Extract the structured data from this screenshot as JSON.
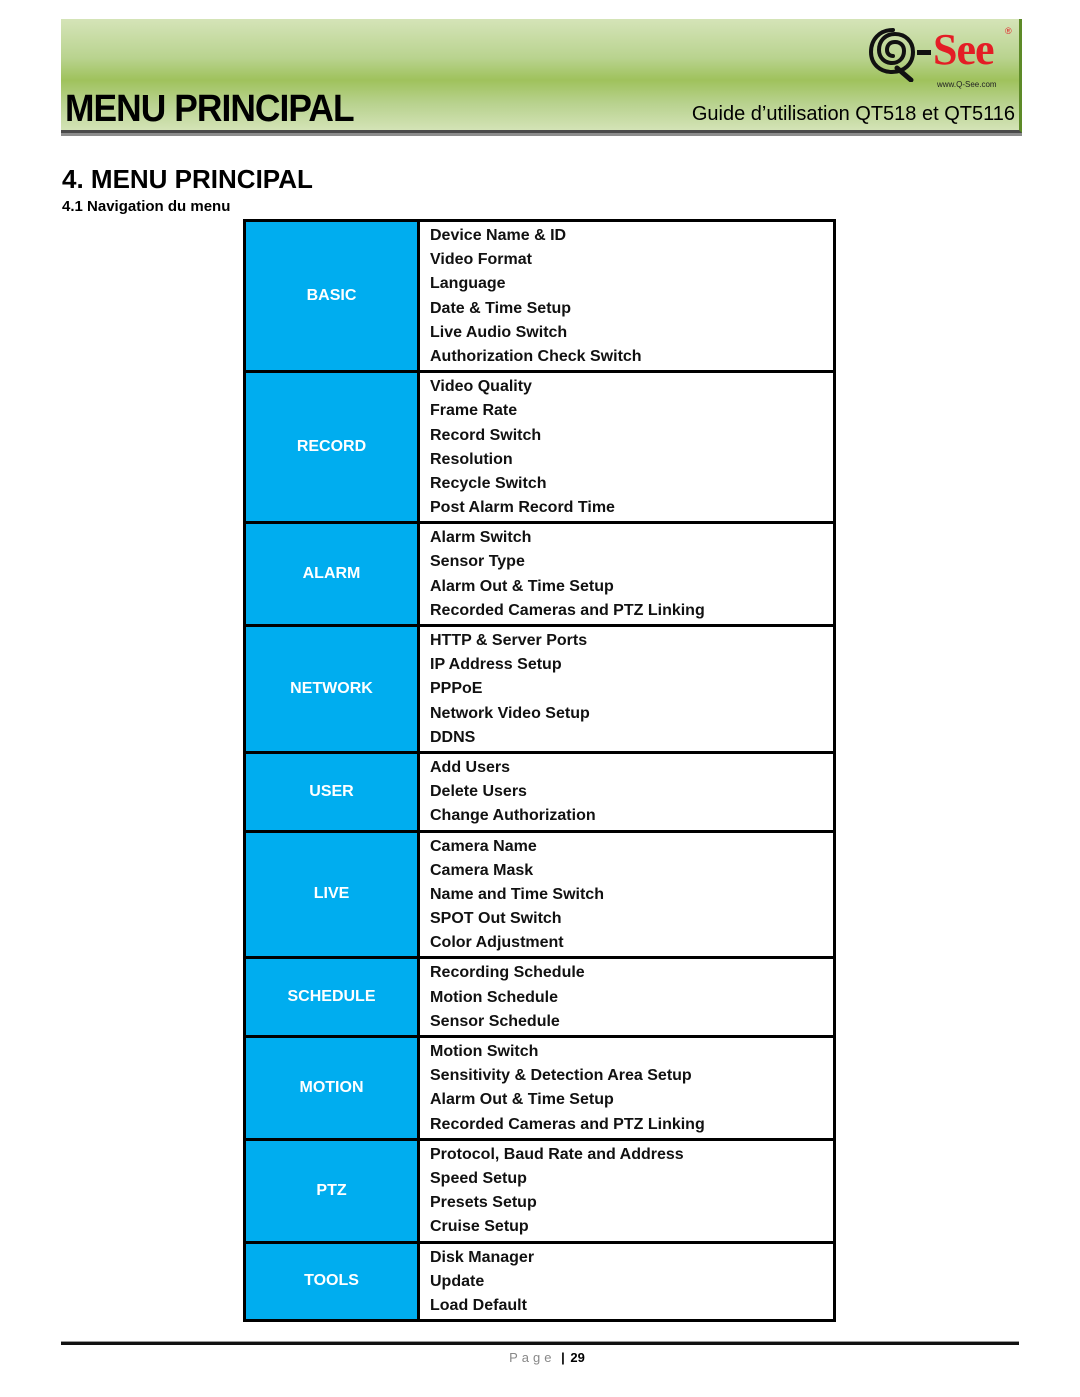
{
  "header": {
    "title": "MENU PRINCIPAL",
    "subtitle": "Guide d’utilisation QT518 et QT5116",
    "logo": {
      "icon": "q-see-swirl-icon",
      "brand_prefix": "Q",
      "brand_name": "See",
      "registered": "®",
      "url": "www.Q-See.com"
    },
    "colors": {
      "banner_green": "#9fc25c",
      "logo_red": "#e41d25"
    }
  },
  "section": {
    "heading": "4. MENU PRINCIPAL",
    "subheading": "4.1 Navigation du menu"
  },
  "menu": {
    "colors": {
      "category_bg": "#00adef",
      "category_text": "#ffffff",
      "border": "#000000"
    },
    "groups": [
      {
        "category": "BASIC",
        "items": [
          "Device Name & ID",
          "Video Format",
          "Language",
          "Date & Time Setup",
          "Live Audio Switch",
          "Authorization Check Switch"
        ]
      },
      {
        "category": "RECORD",
        "items": [
          "Video Quality",
          "Frame Rate",
          "Record Switch",
          "Resolution",
          "Recycle Switch",
          "Post Alarm Record Time"
        ]
      },
      {
        "category": "ALARM",
        "items": [
          "Alarm Switch",
          "Sensor Type",
          "Alarm Out & Time Setup",
          "Recorded Cameras and PTZ Linking"
        ]
      },
      {
        "category": "NETWORK",
        "items": [
          "HTTP & Server Ports",
          "IP Address Setup",
          "PPPoE",
          "Network Video Setup",
          "DDNS"
        ]
      },
      {
        "category": "USER",
        "items": [
          "Add Users",
          "Delete Users",
          "Change Authorization"
        ]
      },
      {
        "category": "LIVE",
        "items": [
          "Camera Name",
          "Camera Mask",
          "Name and Time Switch",
          "SPOT Out Switch",
          "Color Adjustment"
        ]
      },
      {
        "category": "SCHEDULE",
        "items": [
          "Recording Schedule",
          "Motion Schedule",
          "Sensor Schedule"
        ]
      },
      {
        "category": "MOTION",
        "items": [
          "Motion Switch",
          "Sensitivity & Detection Area Setup",
          "Alarm Out & Time Setup",
          "Recorded Cameras and PTZ Linking"
        ]
      },
      {
        "category": "PTZ",
        "items": [
          "Protocol, Baud Rate and Address",
          "Speed Setup",
          "Presets Setup",
          "Cruise Setup"
        ]
      },
      {
        "category": "TOOLS",
        "items": [
          "Disk Manager",
          "Update",
          "Load Default"
        ]
      }
    ]
  },
  "footer": {
    "page_label": "Page",
    "separator": "|",
    "page_number": "29"
  }
}
